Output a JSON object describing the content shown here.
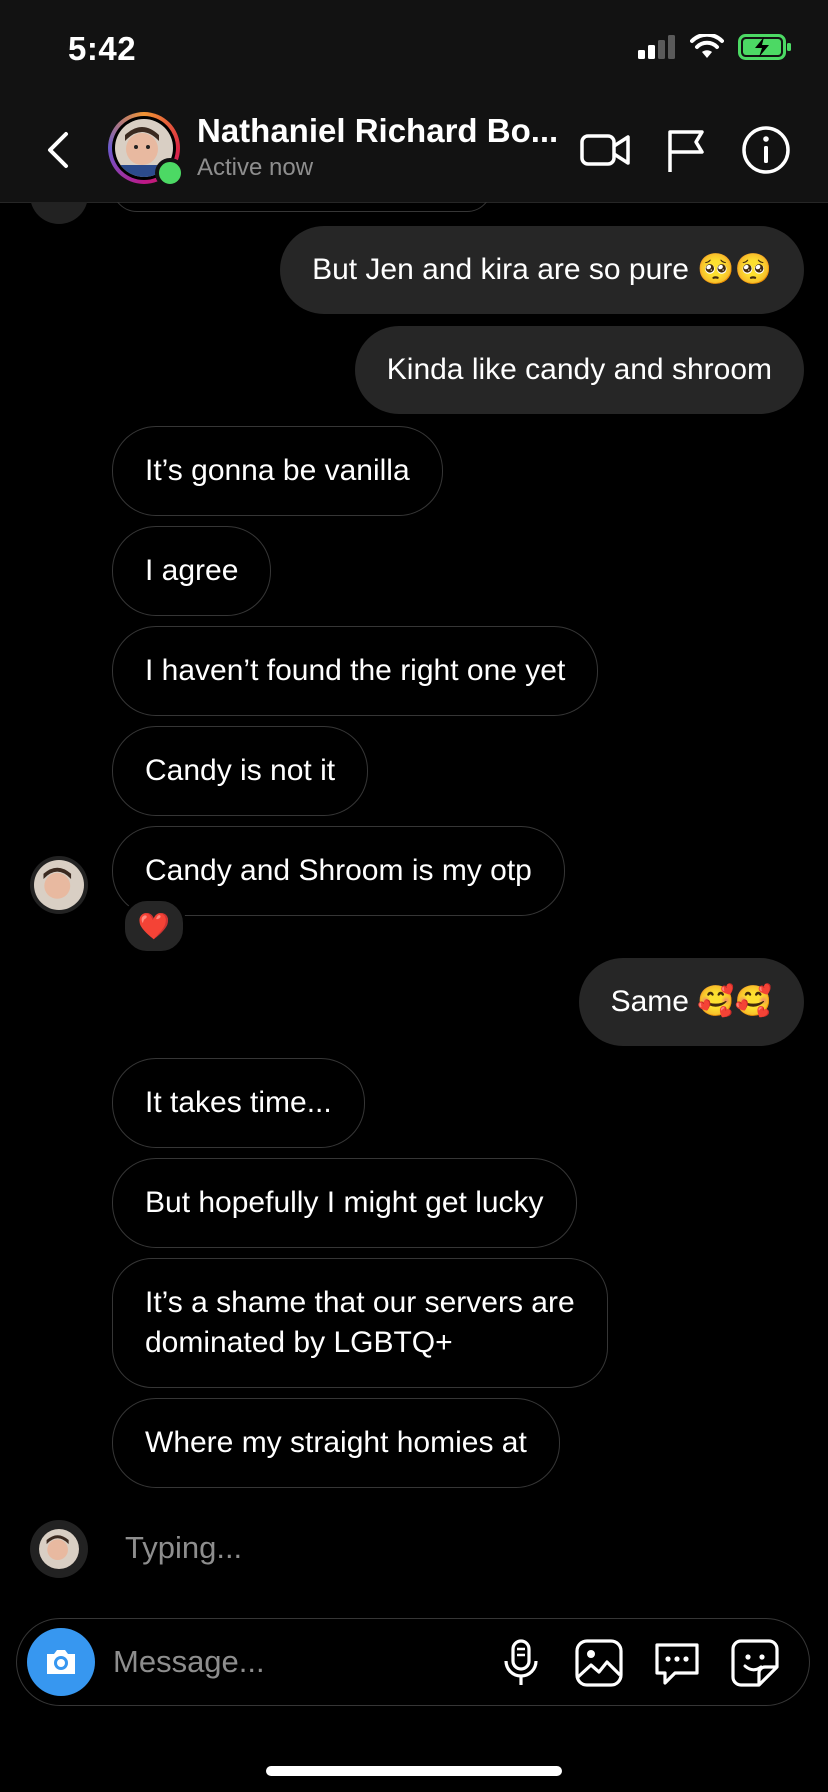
{
  "status_bar": {
    "time": "5:42"
  },
  "header": {
    "name": "Nathaniel Richard Bo...",
    "status": "Active now",
    "icons": [
      "back-chevron-icon",
      "video-camera-icon",
      "flag-icon",
      "info-icon"
    ]
  },
  "messages": [
    {
      "from": "me",
      "text": "But Jen and kira are so pure 🥺🥺"
    },
    {
      "from": "me",
      "text": "Kinda like candy and shroom"
    },
    {
      "from": "them",
      "text": "It’s gonna be vanilla"
    },
    {
      "from": "them",
      "text": "I agree"
    },
    {
      "from": "them",
      "text": "I haven’t found the right one yet"
    },
    {
      "from": "them",
      "text": "Candy is not it"
    },
    {
      "from": "them",
      "text": "Candy and Shroom is my otp",
      "reaction": "❤️"
    },
    {
      "from": "me",
      "text": "Same 🥰🥰"
    },
    {
      "from": "them",
      "text": "It takes time..."
    },
    {
      "from": "them",
      "text": "But hopefully I might get lucky"
    },
    {
      "from": "them",
      "line1": "It’s a shame that our servers are",
      "line2": "dominated by LGBTQ+"
    },
    {
      "from": "them",
      "text": "Where my straight homies at"
    }
  ],
  "typing": "Typing...",
  "composer": {
    "placeholder": "Message...",
    "icons": [
      "camera-icon",
      "microphone-icon",
      "gallery-icon",
      "chat-bubble-icon",
      "sticker-icon"
    ]
  },
  "colors": {
    "background": "#000000",
    "sent_bubble": "#262626",
    "accent": "#3797f0",
    "online": "#4cd964"
  }
}
